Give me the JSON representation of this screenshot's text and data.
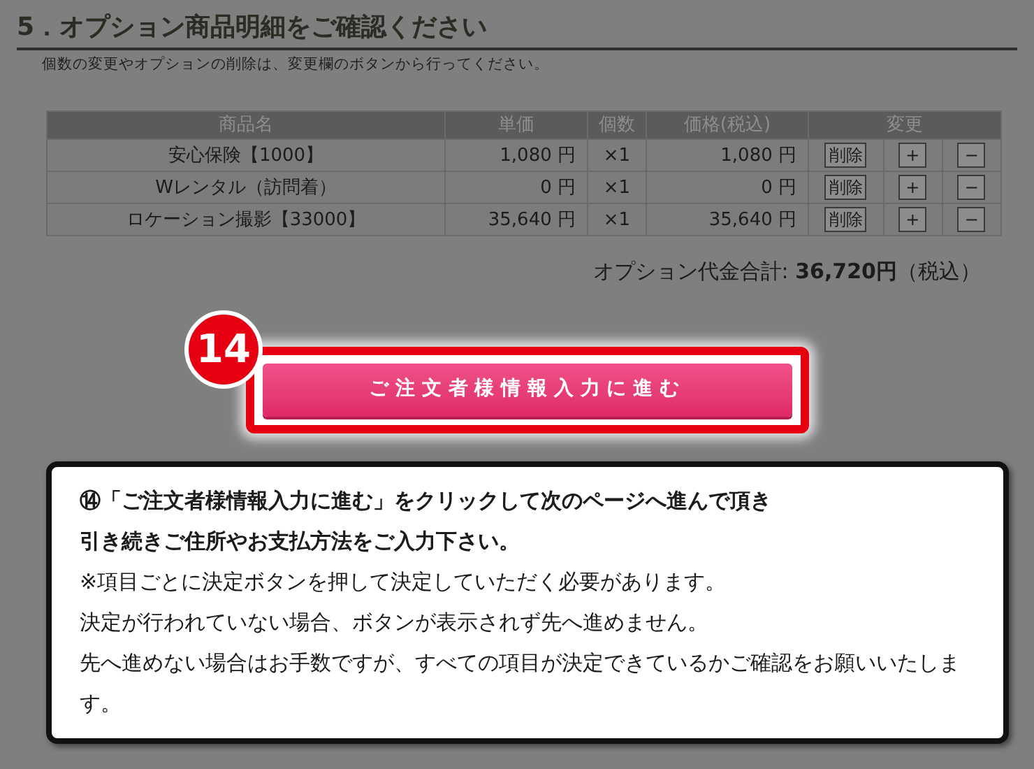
{
  "section": {
    "title": "5．オプション商品明細をご確認ください",
    "description": "個数の変更やオプションの削除は、変更欄のボタンから行ってください。"
  },
  "table": {
    "columns": [
      "商品名",
      "単価",
      "個数",
      "価格(税込)",
      "変更"
    ],
    "rows": [
      {
        "name": "安心保険【1000】",
        "unit_price": "1,080 円",
        "quantity": "×1",
        "price": "1,080 円",
        "delete": "削除",
        "plus": "+",
        "minus": "−"
      },
      {
        "name": "Wレンタル（訪問着）",
        "unit_price": "0 円",
        "quantity": "×1",
        "price": "0 円",
        "delete": "削除",
        "plus": "+",
        "minus": "−"
      },
      {
        "name": "ロケーション撮影【33000】",
        "unit_price": "35,640 円",
        "quantity": "×1",
        "price": "35,640 円",
        "delete": "削除",
        "plus": "+",
        "minus": "−"
      }
    ]
  },
  "total": {
    "label": "オプション代金合計:",
    "amount": "36,720円",
    "note": "（税込）"
  },
  "step_badge": "14",
  "proceed_button": "ご注文者様情報入力に進む",
  "note": {
    "lines": [
      {
        "kind": "bold",
        "text": "⑭「ご注文者様情報入力に進む」をクリックして次のページへ進んで頂き"
      },
      {
        "kind": "bold",
        "text": "引き続きご住所やお支払方法をご入力下さい。"
      },
      {
        "kind": "normal",
        "text": "※項目ごとに決定ボタンを押して決定していただく必要があります。"
      },
      {
        "kind": "normal",
        "text": "決定が行われていない場合、ボタンが表示されず先へ進めません。"
      },
      {
        "kind": "normal",
        "text": "先へ進めない場合はお手数ですが、すべての項目が決定できているかご確認をお願いいたします。"
      }
    ]
  }
}
